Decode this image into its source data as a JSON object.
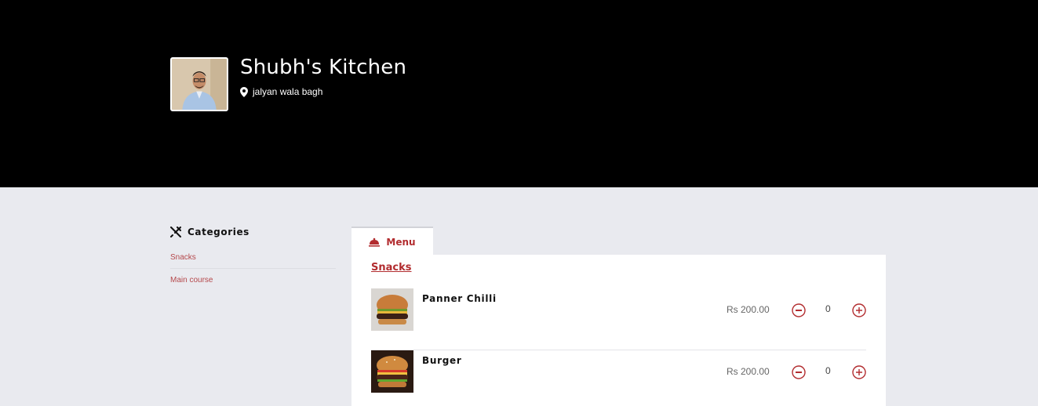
{
  "header": {
    "restaurant_name": "Shubh's Kitchen",
    "location": "jalyan wala bagh"
  },
  "sidebar": {
    "title": "Categories",
    "items": [
      {
        "label": "Snacks"
      },
      {
        "label": "Main course"
      }
    ]
  },
  "main": {
    "tab_label": "Menu",
    "section": "Snacks",
    "items": [
      {
        "name": "Panner Chilli",
        "price": "Rs 200.00",
        "quantity": "0"
      },
      {
        "name": "Burger",
        "price": "Rs 200.00",
        "quantity": "0"
      }
    ]
  },
  "colors": {
    "header_bg": "#000000",
    "page_bg": "#e9eaef",
    "accent": "#b22c2f"
  }
}
